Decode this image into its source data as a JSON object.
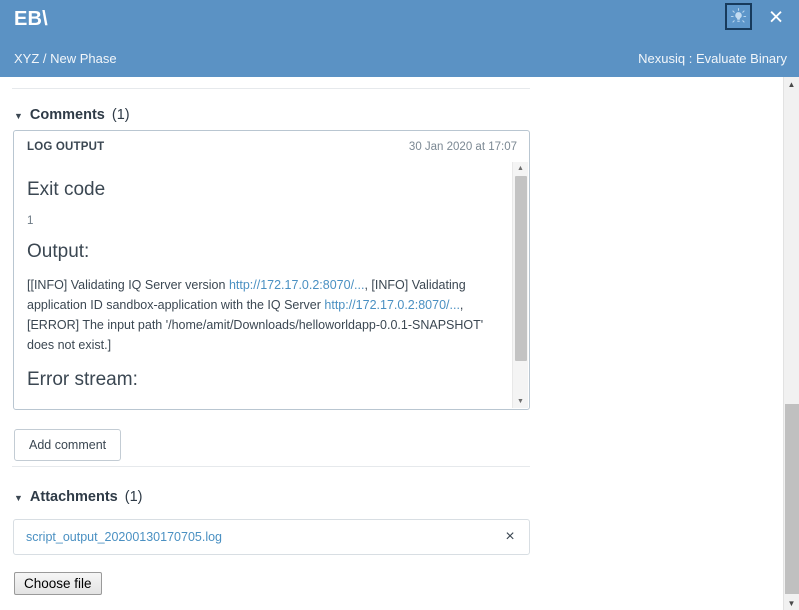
{
  "header": {
    "title": "EB\\",
    "breadcrumb": "XYZ / New Phase",
    "context": "Nexusiq : Evaluate Binary",
    "idea_icon": "lightbulb-idea-icon",
    "close_icon": "×",
    "bg_color": "#5b92c4",
    "text_color": "#ffffff"
  },
  "comments": {
    "caret": "▼",
    "label": "Comments",
    "count": "(1)",
    "card": {
      "label": "LOG OUTPUT",
      "date": "30 Jan 2020 at 17:07",
      "exit_code_heading": "Exit code",
      "exit_code_value": "1",
      "output_heading": "Output:",
      "log_line_pre": "[[INFO] Validating IQ Server version ",
      "log_link_1": "http://172.17.0.2:8070/...",
      "log_line_mid": ", [INFO] Validating application ID sandbox-application with the IQ Server ",
      "log_link_2": "http://172.17.0.2:8070/...",
      "log_line_post": ", [ERROR] The input path '/home/amit/Downloads/helloworldapp-0.0.1-SNAPSHOT' does not exist.]",
      "error_stream_heading": "Error stream:",
      "link_color": "#4a90c2"
    },
    "add_comment_label": "Add comment"
  },
  "attachments": {
    "caret": "▼",
    "label": "Attachments",
    "count": "(1)",
    "items": [
      {
        "name": "script_output_20200130170705.log",
        "remove_icon": "×"
      }
    ],
    "choose_file_label": "Choose file"
  },
  "scrollbars": {
    "up_arrow": "▲",
    "down_arrow": "▼"
  }
}
